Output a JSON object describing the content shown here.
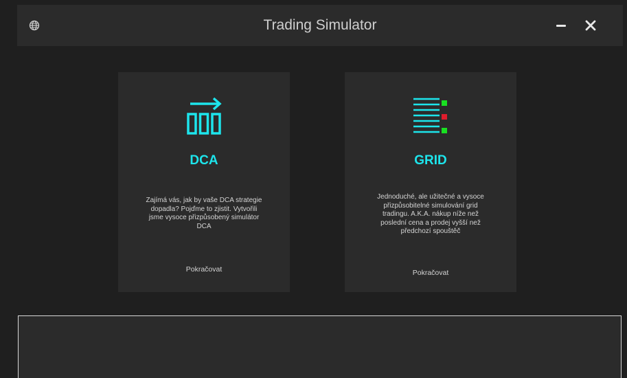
{
  "window": {
    "title": "Trading Simulator",
    "icons": {
      "globe": "globe-icon",
      "minimize": "minimize-icon",
      "close": "close-icon"
    }
  },
  "colors": {
    "accent": "#1de5ec",
    "background": "#1f1f1f",
    "card": "#2b2b2b",
    "grid_buy": "#19e021",
    "grid_sell": "#e01c2c"
  },
  "cards": [
    {
      "title": "DCA",
      "icon": "dca-arrow-boxes-icon",
      "description": "Zajímá vás, jak by vaše DCA strategie dopadla? Pojďme to zjistit. Vytvořili jsme vysoce přizpůsobený simulátor DCA",
      "cta": "Pokračovat"
    },
    {
      "title": "GRID",
      "icon": "grid-lines-icon",
      "description": "Jednoduché, ale užitečné a vysoce přizpůsobitelné simulování grid tradingu. A.K.A. nákup níže než poslední cena a prodej vyšší než předchozí spouštěč",
      "cta": "Pokračovat"
    }
  ]
}
